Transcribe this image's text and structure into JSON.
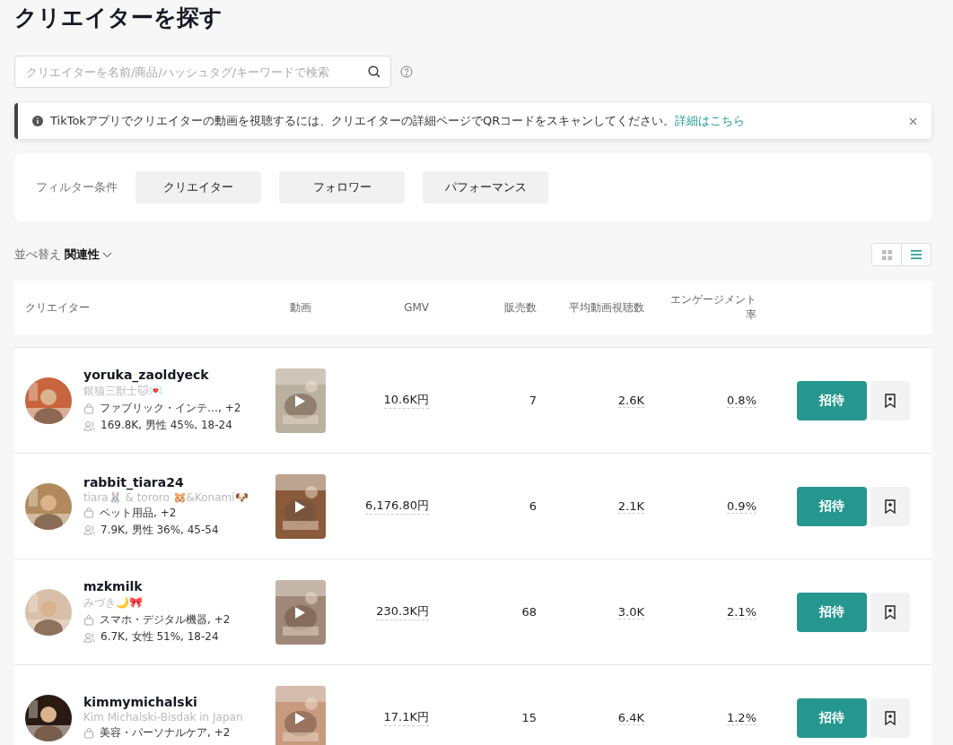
{
  "title": "クリエイターを探す",
  "search": {
    "placeholder": "クリエイターを名前/商品/ハッシュタグ/キーワードで検索"
  },
  "notice": {
    "text": "TikTokアプリでクリエイターの動画を視聴するには、クリエイターの詳細ページでQRコードをスキャンしてください。",
    "link": "詳細はこちら"
  },
  "filters": {
    "label": "フィルター条件",
    "buttons": [
      "クリエイター",
      "フォロワー",
      "パフォーマンス"
    ]
  },
  "sort": {
    "label": "並べ替え",
    "value": "関連性"
  },
  "view_toggle": [
    {
      "kind": "grid",
      "selected": false
    },
    {
      "kind": "list",
      "selected": true
    }
  ],
  "table": {
    "columns": [
      "クリエイター",
      "動画",
      "GMV",
      "販売数",
      "平均動画視聴数",
      "エンゲージメント率"
    ],
    "rows": [
      {
        "name": "yoruka_zaoldyeck",
        "subtitle": "銀猫三獣士🐱💌",
        "category": "ファブリック・インテ…, +2",
        "audience": "169.8K, 男性 45%, 18-24",
        "gmv": "10.6K円",
        "sales": "7",
        "views": "2.6K",
        "engagement": "0.8%",
        "invite": "招待"
      },
      {
        "name": "rabbit_tiara24",
        "subtitle": "tiara🐰 & tororo 🐹&Konami🐶",
        "category": "ペット用品, +2",
        "audience": "7.9K, 男性 36%, 45-54",
        "gmv": "6,176.80円",
        "sales": "6",
        "views": "2.1K",
        "engagement": "0.9%",
        "invite": "招待"
      },
      {
        "name": "mzkmilk",
        "subtitle": "みづき🌙🎀",
        "category": "スマホ・デジタル機器, +2",
        "audience": "6.7K, 女性 51%, 18-24",
        "gmv": "230.3K円",
        "sales": "68",
        "views": "3.0K",
        "engagement": "2.1%",
        "invite": "招待"
      },
      {
        "name": "kimmymichalski",
        "subtitle": "Kim Michalski-Bisdak in Japan",
        "category": "美容・パーソナルケア, +2",
        "gmv": "17.1K円",
        "sales": "15",
        "views": "6.4K",
        "engagement": "1.2%",
        "invite": "招待"
      }
    ]
  }
}
